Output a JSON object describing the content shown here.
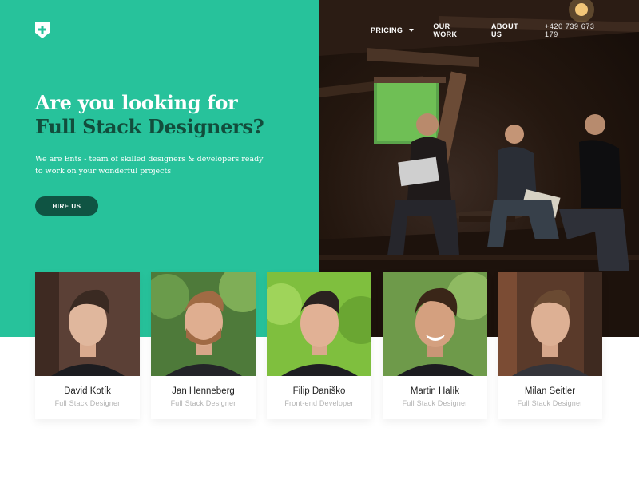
{
  "nav": {
    "items": [
      {
        "label": "PRICING",
        "has_dropdown": true
      },
      {
        "label": "OUR WORK",
        "has_dropdown": false
      },
      {
        "label": "ABOUT US",
        "has_dropdown": false
      }
    ],
    "phone": "+420 739 673 179"
  },
  "logo": {
    "icon": "shield-plus-icon"
  },
  "hero": {
    "headline_line1": "Are you looking for",
    "headline_line2": "Full Stack Designers?",
    "subtitle": "We are Ents - team of skilled designers & developers ready to work on your wonderful projects",
    "cta_label": "HIRE US",
    "photo": "team-working-in-attic-photo"
  },
  "team": [
    {
      "name": "David Kotík",
      "role": "Full Stack Designer"
    },
    {
      "name": "Jan Henneberg",
      "role": "Full Stack Designer"
    },
    {
      "name": "Filip Daniško",
      "role": "Front-end Developer"
    },
    {
      "name": "Martin Halík",
      "role": "Full Stack Designer"
    },
    {
      "name": "Milan Seitler",
      "role": "Full Stack Designer"
    }
  ],
  "colors": {
    "accent": "#27c29b",
    "dark_green": "#124d3c",
    "button": "#0f5443",
    "name_text": "#222222",
    "role_text": "#b4b4b4"
  }
}
